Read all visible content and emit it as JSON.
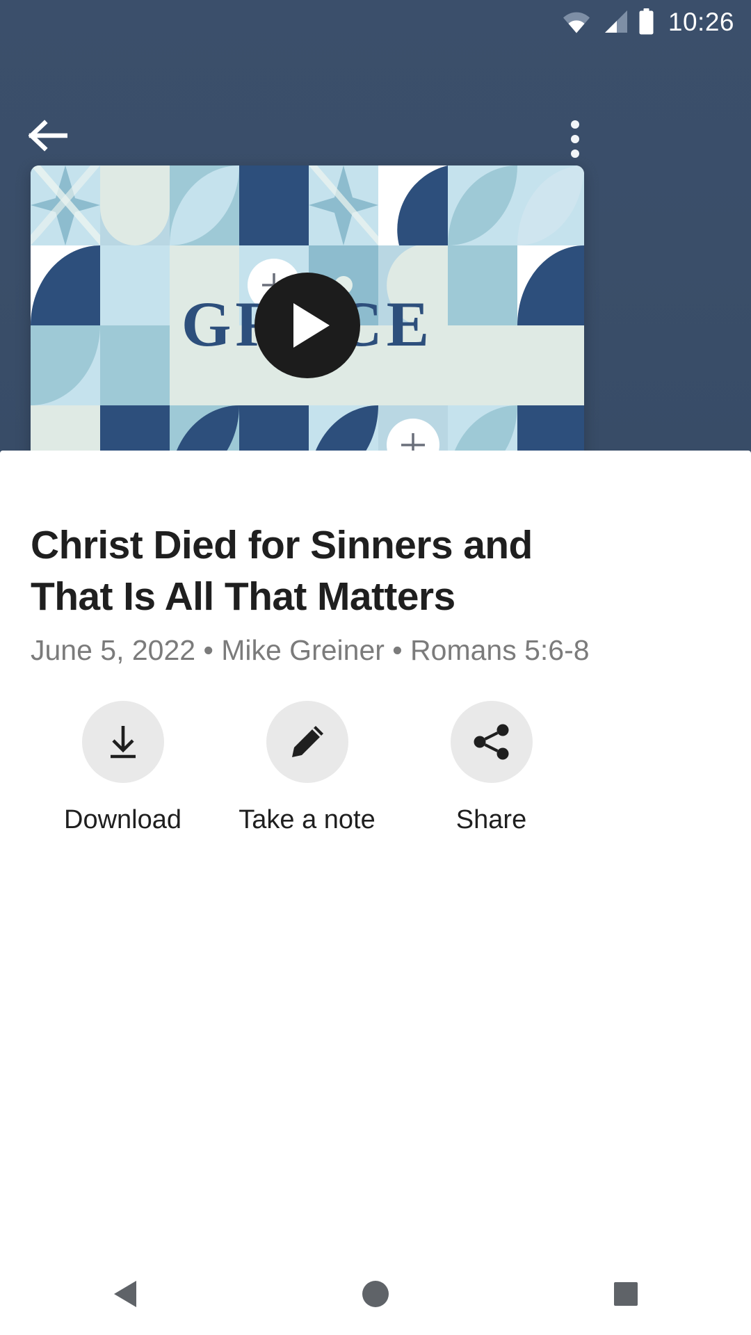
{
  "status_bar": {
    "clock": "10:26",
    "icons": [
      "wifi-icon",
      "cellular-signal-icon",
      "battery-icon"
    ]
  },
  "app_bar": {
    "back_icon": "arrow-left-icon",
    "overflow_icon": "more-vertical-icon"
  },
  "media": {
    "thumbnail_wordmark": "GRACE",
    "play_icon": "play-icon",
    "artwork_palette": {
      "navy": "#2d4f7c",
      "teal": "#9ec9d6",
      "steel_blue": "#8dbcce",
      "light_blue": "#c5e2ed",
      "pale_mint": "#dfeae4",
      "white": "#ffffff",
      "header_background": "#3b4f6b"
    }
  },
  "sermon": {
    "title": "Christ Died for Sinners and That Is All That Matters",
    "date": "June 5, 2022",
    "speaker": "Mike Greiner",
    "scripture": "Romans 5:6-8",
    "meta_line": "June 5, 2022 • Mike Greiner • Romans 5:6-8"
  },
  "actions": [
    {
      "label": "Download",
      "icon": "download-icon"
    },
    {
      "label": "Take a note",
      "icon": "pencil-icon"
    },
    {
      "label": "Share",
      "icon": "share-nodes-icon"
    }
  ],
  "navigation_bar": {
    "back": "nav-back-triangle-icon",
    "home": "nav-home-circle-icon",
    "recents": "nav-recents-square-icon"
  }
}
